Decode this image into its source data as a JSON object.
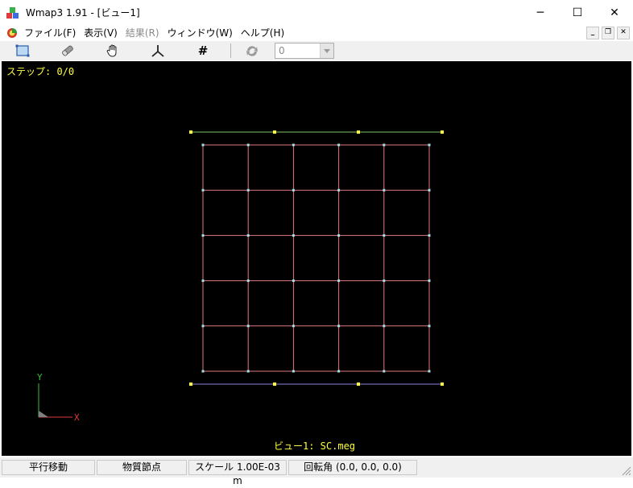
{
  "window": {
    "title": "Wmap3 1.91 - [ビュー1]",
    "minimize": "─",
    "maximize": "☐",
    "close": "✕"
  },
  "menu": {
    "items": [
      {
        "label": "ファイル(F)",
        "enabled": true
      },
      {
        "label": "表示(V)",
        "enabled": true
      },
      {
        "label": "結果(R)",
        "enabled": false
      },
      {
        "label": "ウィンドウ(W)",
        "enabled": true
      },
      {
        "label": "ヘルプ(H)",
        "enabled": true
      }
    ],
    "mdi_minimize": "_",
    "mdi_restore": "❐",
    "mdi_close": "✕"
  },
  "toolbar": {
    "icons": [
      "frame-icon",
      "eraser-icon",
      "hand-icon",
      "axes-icon",
      "grid-icon",
      "rotate-icon"
    ],
    "grid_symbol": "#",
    "combo_value": "0"
  },
  "view": {
    "step_label": "ステップ: 0/0",
    "caption": "ビュー1: SC.meg",
    "axis_x": "X",
    "axis_y": "Y",
    "colors": {
      "background": "#000000",
      "mesh_line": "#e07a7a",
      "mesh_node": "#a6dff0",
      "boundary_top": "#7ec46b",
      "boundary_bottom": "#8a84e0",
      "boundary_node": "#ffff40",
      "label": "#ffff40"
    }
  },
  "status": {
    "mode": "平行移動",
    "material": "物質節点",
    "scale": "スケール 1.00E-03 m",
    "rotation": "回転角 (0.0, 0.0, 0.0)"
  }
}
